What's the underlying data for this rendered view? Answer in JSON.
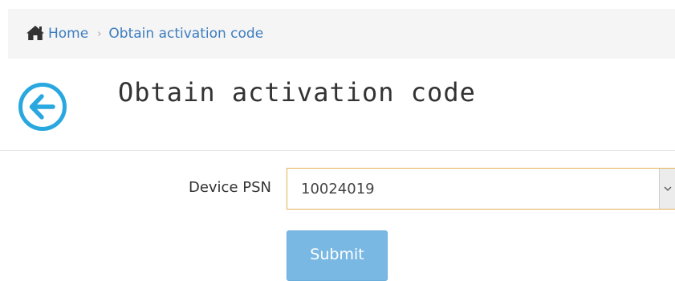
{
  "breadcrumb": {
    "home_label": "Home",
    "separator": "›",
    "current_label": "Obtain activation code"
  },
  "header": {
    "title": "Obtain activation code"
  },
  "form": {
    "device_psn_label": "Device PSN",
    "device_psn_value": "10024019",
    "submit_label": "Submit"
  },
  "icons": {
    "home": "home-icon",
    "back": "arrow-left-circle-icon",
    "dropdown": "chevron-down-icon"
  },
  "colors": {
    "link": "#3d7dbf",
    "back_icon": "#29a8e0",
    "select_focus_border": "#e3b25a",
    "submit_bg": "#7ab8e4"
  }
}
